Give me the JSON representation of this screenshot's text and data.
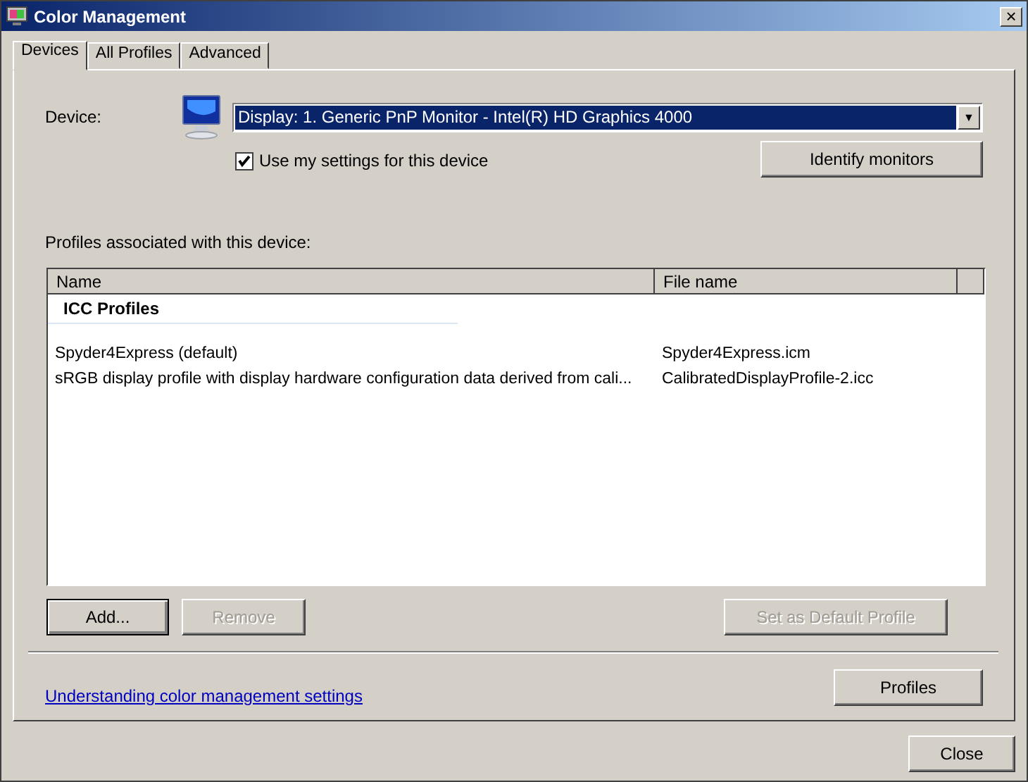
{
  "window": {
    "title": "Color Management",
    "close": "×"
  },
  "tabs": [
    {
      "label": "Devices",
      "selected": true
    },
    {
      "label": "All Profiles",
      "selected": false
    },
    {
      "label": "Advanced",
      "selected": false
    }
  ],
  "device": {
    "label": "Device:",
    "value": "Display: 1. Generic PnP Monitor - Intel(R) HD Graphics 4000",
    "arrow": "▼"
  },
  "use_my_settings": {
    "label": "Use my settings for this device",
    "checked": true
  },
  "identify_button": {
    "label": "Identify monitors",
    "disabled": false
  },
  "profiles_label": "Profiles associated with this device:",
  "table": {
    "columns": [
      "Name",
      "File name"
    ],
    "group": "ICC Profiles",
    "rows": [
      {
        "name": "Spyder4Express (default)",
        "file": "Spyder4Express.icm"
      },
      {
        "name": "sRGB display profile with display hardware configuration data derived from cali...",
        "file": "CalibratedDisplayProfile-2.icc"
      }
    ]
  },
  "list_buttons": [
    {
      "label": "Add...",
      "disabled": false,
      "bold": true
    },
    {
      "label": "Remove",
      "disabled": true,
      "bold": false
    },
    {
      "label": "Set as Default Profile",
      "disabled": true,
      "bold": false
    }
  ],
  "link": "Understanding color management settings",
  "profiles_button": {
    "label": "Profiles",
    "disabled": false
  },
  "close_button": {
    "label": "Close",
    "disabled": false
  }
}
